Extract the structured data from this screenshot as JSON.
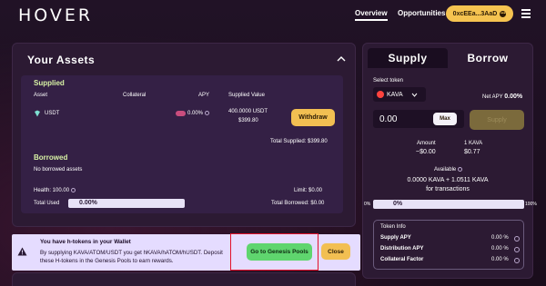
{
  "header": {
    "logo": "HOVER",
    "nav": [
      "Overview",
      "Opportunities"
    ],
    "wallet_address": "0xcEEa...3AaD"
  },
  "assets": {
    "title": "Your Assets",
    "supplied": {
      "heading": "Supplied",
      "columns": [
        "Asset",
        "Collateral",
        "APY",
        "Supplied Value"
      ],
      "row": {
        "asset": "USDT",
        "apy": "0.00%",
        "value_token": "400.0000 USDT",
        "value_usd": "$399.80",
        "action": "Withdraw"
      },
      "total": "Total Supplied: $399.80"
    },
    "borrowed": {
      "heading": "Borrowed",
      "empty": "No borrowed assets",
      "health_label": "Health: 100.00",
      "limit_label": "Limit: $0.00",
      "total_used_label": "Total Used",
      "total_used_pct": "0.00%",
      "total_used_fraction": 0.0,
      "total_borrowed": "Total Borrowed: $0.00"
    }
  },
  "right_panel": {
    "tabs": [
      "Supply",
      "Borrow"
    ],
    "select_token_label": "Select token",
    "token": "KAVA",
    "net_apy_label": "Net APY",
    "net_apy_value": "0.00%",
    "amount": "0.00",
    "max_label": "Max",
    "supply_label": "Supply",
    "amount_label": "Amount",
    "amount_value": "~$0.00",
    "rate_label": "1 KAVA",
    "rate_value": "$0.77",
    "available_label": "Available",
    "available_value": "0.0000 KAVA + 1.0511 KAVA",
    "for_tx": "for transactions",
    "slider_left": "0%",
    "slider_value": "0%",
    "slider_right": "100%",
    "slider_fraction": 0.0,
    "token_info": {
      "title": "Token Info",
      "rows": [
        {
          "label": "Supply APY",
          "value": "0.00 %"
        },
        {
          "label": "Distribution APY",
          "value": "0.00 %"
        },
        {
          "label": "Collateral Factor",
          "value": "0.00 %"
        }
      ]
    }
  },
  "banner": {
    "title": "You have h-tokens in your Wallet",
    "body": "By supplying KAVA/ATOM/USDT you get hKAVA/hATOM/hUSDT. Deposit these H-tokens in the Genesis Pools to earn rewards.",
    "primary_button": "Go to Genesis Pools",
    "close_button": "Close"
  },
  "colors": {
    "accent_yellow": "#f2bf52",
    "accent_green": "#5fd56e",
    "section_heading": "#d8f2a5",
    "highlight": "#e1112a"
  }
}
